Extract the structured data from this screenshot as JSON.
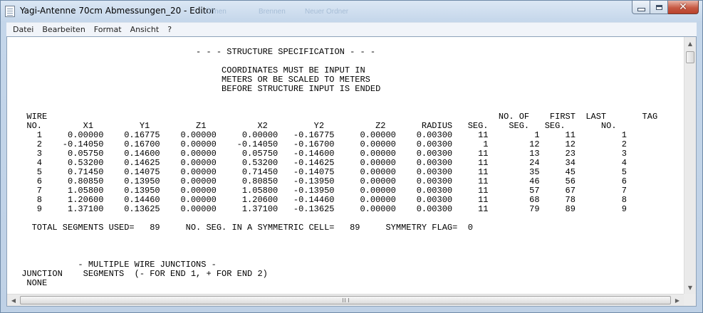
{
  "window": {
    "title": "Yagi-Antenne 70cm Abmessungen_20 - Editor",
    "background_taskbar_ghosts": [
      "Öffnen",
      "Brennen",
      "Neuer Ordner"
    ]
  },
  "caption_buttons": {
    "minimize": "minimize",
    "maximize": "maximize",
    "close": "✕"
  },
  "menubar": {
    "items": [
      "Datei",
      "Bearbeiten",
      "Format",
      "Ansicht",
      "?"
    ]
  },
  "document": {
    "lines": [
      "                                   - - - STRUCTURE SPECIFICATION - - -",
      "",
      "                                        COORDINATES MUST BE INPUT IN",
      "                                        METERS OR BE SCALED TO METERS",
      "                                        BEFORE STRUCTURE INPUT IS ENDED",
      "",
      "",
      "  WIRE                                                                                        NO. OF    FIRST  LAST       TAG",
      "  NO.        X1         Y1         Z1          X2         Y2          Z2       RADIUS   SEG.    SEG.   SEG.       NO.",
      "    1     0.00000    0.16775    0.00000     0.00000   -0.16775     0.00000    0.00300     11         1     11         1",
      "    2    -0.14050    0.16700    0.00000    -0.14050   -0.16700     0.00000    0.00300      1        12     12         2",
      "    3     0.05750    0.14600    0.00000     0.05750   -0.14600     0.00000    0.00300     11        13     23         3",
      "    4     0.53200    0.14625    0.00000     0.53200   -0.14625     0.00000    0.00300     11        24     34         4",
      "    5     0.71450    0.14075    0.00000     0.71450   -0.14075     0.00000    0.00300     11        35     45         5",
      "    6     0.80850    0.13950    0.00000     0.80850   -0.13950     0.00000    0.00300     11        46     56         6",
      "    7     1.05800    0.13950    0.00000     1.05800   -0.13950     0.00000    0.00300     11        57     67         7",
      "    8     1.20600    0.14460    0.00000     1.20600   -0.14460     0.00000    0.00300     11        68     78         8",
      "    9     1.37100    0.13625    0.00000     1.37100   -0.13625     0.00000    0.00300     11        79     89         9",
      "",
      "   TOTAL SEGMENTS USED=   89     NO. SEG. IN A SYMMETRIC CELL=   89     SYMMETRY FLAG=  0",
      "",
      "",
      "",
      "            - MULTIPLE WIRE JUNCTIONS -",
      " JUNCTION    SEGMENTS  (- FOR END 1, + FOR END 2)",
      "  NONE"
    ]
  },
  "scrollbars": {
    "up_arrow": "▲",
    "down_arrow": "▼",
    "left_arrow": "◀",
    "right_arrow": "▶"
  }
}
